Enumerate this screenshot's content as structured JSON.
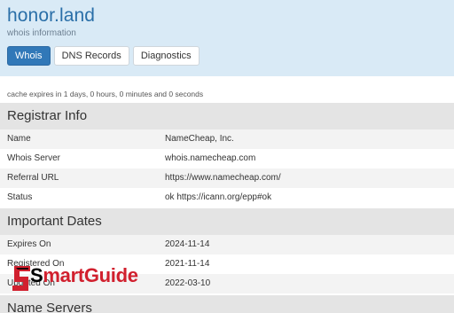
{
  "header": {
    "domain": "honor.land",
    "subtitle": "whois information"
  },
  "tabs": [
    {
      "label": "Whois",
      "active": true
    },
    {
      "label": "DNS Records",
      "active": false
    },
    {
      "label": "Diagnostics",
      "active": false
    }
  ],
  "cache_note": "cache expires in 1 days, 0 hours, 0 minutes and 0 seconds",
  "registrar_info": {
    "heading": "Registrar Info",
    "rows": [
      {
        "key": "Name",
        "value": "NameCheap, Inc."
      },
      {
        "key": "Whois Server",
        "value": "whois.namecheap.com"
      },
      {
        "key": "Referral URL",
        "value": "https://www.namecheap.com/"
      },
      {
        "key": "Status",
        "value": "ok https://icann.org/epp#ok"
      }
    ]
  },
  "important_dates": {
    "heading": "Important Dates",
    "rows": [
      {
        "key": "Expires On",
        "value": "2024-11-14"
      },
      {
        "key": "Registered On",
        "value": "2021-11-14"
      },
      {
        "key": "Updated On",
        "value": "2022-03-10"
      }
    ]
  },
  "name_servers": {
    "heading": "Name Servers"
  },
  "watermark": {
    "prefix": "S",
    "rest": "martGuide"
  },
  "colors": {
    "accent": "#3178b8",
    "header_bg": "#d9eaf6",
    "section_bg": "#e4e4e4",
    "watermark_red": "#d1202e"
  }
}
